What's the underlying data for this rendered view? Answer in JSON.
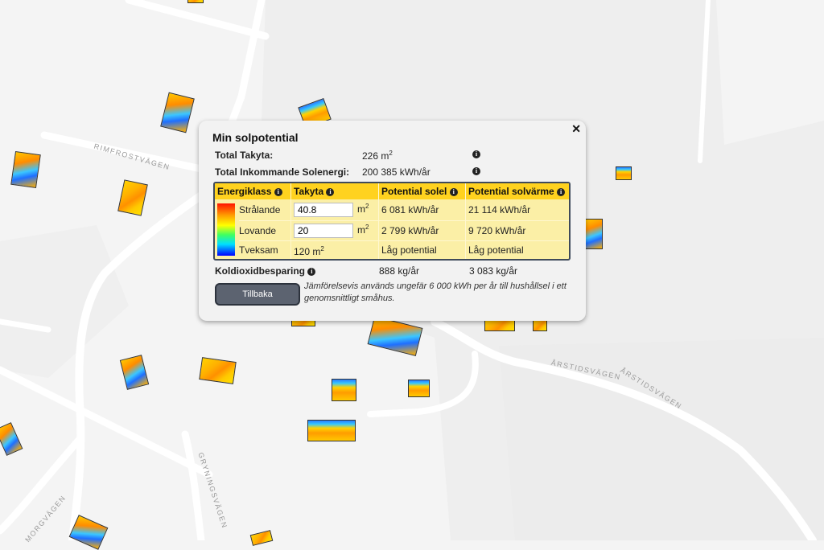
{
  "map": {
    "streets": [
      "RIMFROSTVÄGEN",
      "ÅRSTIDSVÄGEN",
      "ÅRSTIDSVÄGEN",
      "GRYNINGSVÄGEN",
      "MORGVÄGEN"
    ]
  },
  "popup": {
    "title": "Min solpotential",
    "close_symbol": "✕",
    "total_area_label": "Total Takyta:",
    "total_area_value": "226 m",
    "total_area_sup": "2",
    "total_energy_label": "Total Inkommande Solenergi:",
    "total_energy_value": "200 385 kWh/år",
    "info_symbol": "i",
    "table": {
      "headers": [
        "Energiklass",
        "Takyta",
        "Potential solel",
        "Potential solvärme"
      ],
      "rows": [
        {
          "class": "Strålande",
          "area": "40.8",
          "unit": "m",
          "sup": "2",
          "solel": "6 081 kWh/år",
          "solvarme": "21 114 kWh/år"
        },
        {
          "class": "Lovande",
          "area": "20",
          "unit": "m",
          "sup": "2",
          "solel": "2 799 kWh/år",
          "solvarme": "9 720 kWh/år"
        },
        {
          "class": "Tveksam",
          "area": "120 m",
          "sup": "2",
          "solel": "Låg potential",
          "solvarme": "Låg potential"
        }
      ]
    },
    "co2_label": "Koldioxidbesparing",
    "co2_solel": "888 kg/år",
    "co2_solvarme": "3 083 kg/år",
    "back_button": "Tillbaka",
    "note": "Jämförelsevis används ungefär 6 000 kWh per år till hushållsel i ett genomsnittligt småhus."
  },
  "colors": {
    "header": "#ffd21f",
    "table_bg": "#fbefa6",
    "button": "#5c6370"
  }
}
